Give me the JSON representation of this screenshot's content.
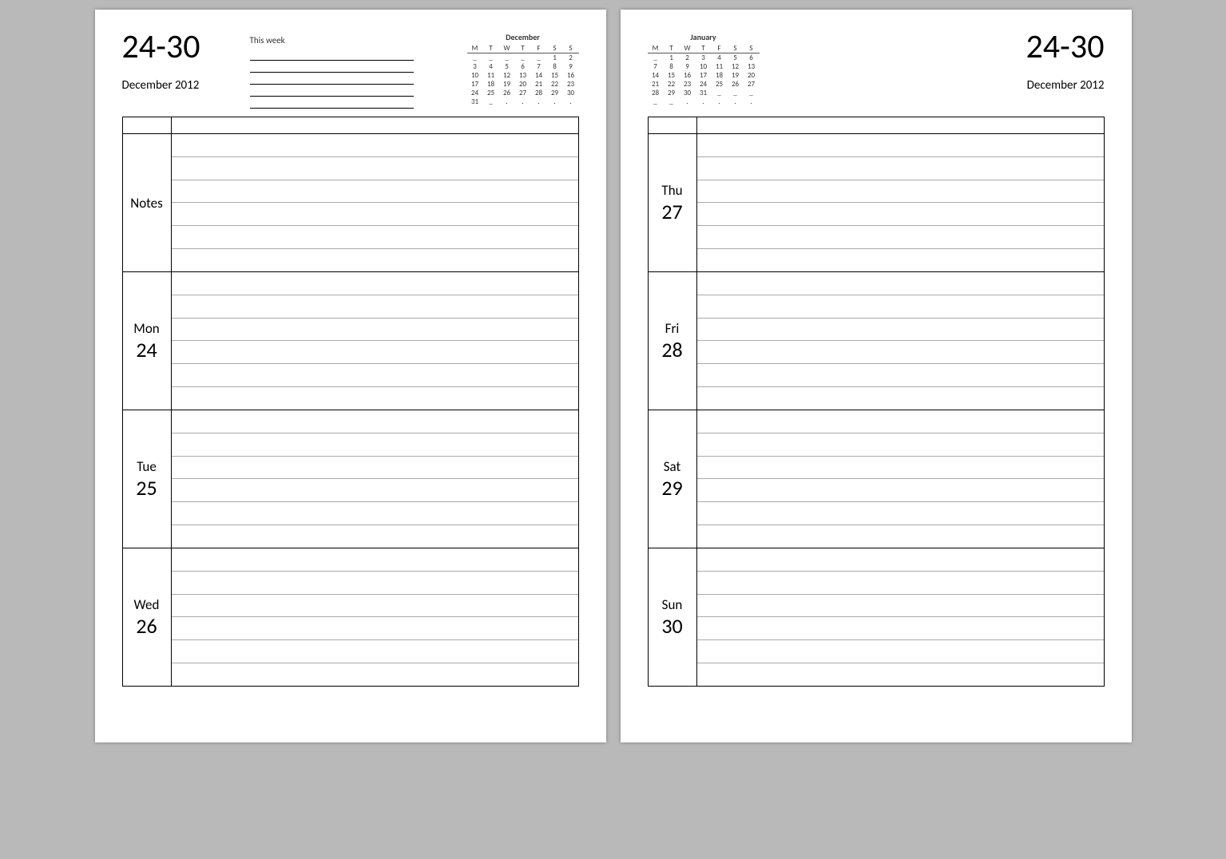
{
  "range": "24-30",
  "monthyear": "December 2012",
  "thisweek_label": "This week",
  "left_blocks": [
    {
      "type": "notes",
      "label": "Notes"
    },
    {
      "type": "day",
      "dname": "Mon",
      "dnum": "24"
    },
    {
      "type": "day",
      "dname": "Tue",
      "dnum": "25"
    },
    {
      "type": "day",
      "dname": "Wed",
      "dnum": "26"
    }
  ],
  "right_blocks": [
    {
      "type": "day",
      "dname": "Thu",
      "dnum": "27"
    },
    {
      "type": "day",
      "dname": "Fri",
      "dnum": "28"
    },
    {
      "type": "day",
      "dname": "Sat",
      "dnum": "29"
    },
    {
      "type": "day",
      "dname": "Sun",
      "dnum": "30"
    }
  ],
  "minical_left": {
    "name": "December",
    "dow": [
      "M",
      "T",
      "W",
      "T",
      "F",
      "S",
      "S"
    ],
    "rows": [
      [
        "_",
        "_",
        "_",
        "_",
        "_",
        "1",
        "2"
      ],
      [
        "3",
        "4",
        "5",
        "6",
        "7",
        "8",
        "9"
      ],
      [
        "10",
        "11",
        "12",
        "13",
        "14",
        "15",
        "16"
      ],
      [
        "17",
        "18",
        "19",
        "20",
        "21",
        "22",
        "23"
      ],
      [
        "24",
        "25",
        "26",
        "27",
        "28",
        "29",
        "30"
      ],
      [
        "31",
        "_",
        ".",
        ".",
        ".",
        ".",
        "."
      ]
    ]
  },
  "minical_right": {
    "name": "January",
    "dow": [
      "M",
      "T",
      "W",
      "T",
      "F",
      "S",
      "S"
    ],
    "rows": [
      [
        "_",
        "1",
        "2",
        "3",
        "4",
        "5",
        "6"
      ],
      [
        "7",
        "8",
        "9",
        "10",
        "11",
        "12",
        "13"
      ],
      [
        "14",
        "15",
        "16",
        "17",
        "18",
        "19",
        "20"
      ],
      [
        "21",
        "22",
        "23",
        "24",
        "25",
        "26",
        "27"
      ],
      [
        "28",
        "29",
        "30",
        "31",
        "_",
        "_",
        "_"
      ],
      [
        "_",
        "_",
        ".",
        ".",
        ".",
        ".",
        "."
      ]
    ]
  }
}
